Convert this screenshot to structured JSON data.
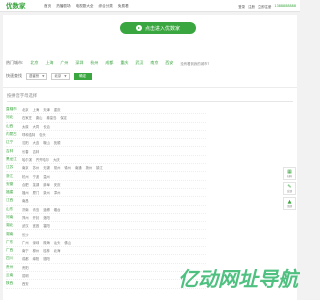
{
  "header": {
    "logo": "优数家",
    "nav": [
      "首页",
      "热播剧场",
      "电视剧大全",
      "综合分类",
      "免费看"
    ],
    "links": [
      "登录",
      "注册",
      "立即注册"
    ],
    "phone": "1388888888"
  },
  "main": {
    "enter_button": "点击进入优数家",
    "hot_cities": {
      "title": "热门城市:",
      "cities": [
        "北京",
        "上海",
        "广州",
        "深圳",
        "杭州",
        "成都",
        "重庆",
        "武汉",
        "南京",
        "西安"
      ],
      "more": "没有看到我的城市?"
    },
    "quick_select": {
      "title": "快速查找",
      "province": "选省份",
      "city": "北京",
      "go": "确定"
    },
    "az_title": "按拼音字母选择",
    "provinces": [
      {
        "name": "直辖市",
        "cities": [
          "北京",
          "上海",
          "天津",
          "重庆"
        ]
      },
      {
        "name": "河北",
        "cities": [
          "石家庄",
          "唐山",
          "秦皇岛",
          "保定"
        ]
      },
      {
        "name": "山西",
        "cities": [
          "太原",
          "大同",
          "长治"
        ]
      },
      {
        "name": "内蒙古",
        "cities": [
          "呼和浩特",
          "包头"
        ]
      },
      {
        "name": "辽宁",
        "cities": [
          "沈阳",
          "大连",
          "鞍山",
          "抚顺"
        ]
      },
      {
        "name": "吉林",
        "cities": [
          "长春",
          "吉林"
        ]
      },
      {
        "name": "黑龙江",
        "cities": [
          "哈尔滨",
          "齐齐哈尔",
          "大庆"
        ]
      },
      {
        "name": "江苏",
        "cities": [
          "南京",
          "苏州",
          "无锡",
          "常州",
          "徐州",
          "南通",
          "扬州",
          "镇江"
        ]
      },
      {
        "name": "浙江",
        "cities": [
          "杭州",
          "宁波",
          "温州"
        ]
      },
      {
        "name": "安徽",
        "cities": [
          "合肥",
          "芜湖",
          "蚌埠",
          "安庆"
        ]
      },
      {
        "name": "福建",
        "cities": [
          "福州",
          "厦门",
          "泉州",
          "漳州"
        ]
      },
      {
        "name": "江西",
        "cities": [
          "南昌"
        ]
      },
      {
        "name": "山东",
        "cities": [
          "济南",
          "青岛",
          "淄博",
          "烟台"
        ]
      },
      {
        "name": "河南",
        "cities": [
          "郑州",
          "开封",
          "洛阳"
        ]
      },
      {
        "name": "湖北",
        "cities": [
          "武汉",
          "宜昌",
          "襄阳"
        ]
      },
      {
        "name": "湖南",
        "cities": [
          "长沙"
        ]
      },
      {
        "name": "广东",
        "cities": [
          "广州",
          "深圳",
          "珠海",
          "汕头",
          "佛山"
        ]
      },
      {
        "name": "广西",
        "cities": [
          "南宁",
          "柳州",
          "桂林",
          "北海"
        ]
      },
      {
        "name": "四川",
        "cities": [
          "成都",
          "绵阳",
          "德阳"
        ]
      },
      {
        "name": "贵州",
        "cities": [
          "贵阳"
        ]
      },
      {
        "name": "云南",
        "cities": [
          "昆明"
        ]
      },
      {
        "name": "陕西",
        "cities": [
          "西安"
        ]
      }
    ]
  },
  "side_tools": [
    {
      "icon": "qr-code-icon",
      "label": "扫码"
    },
    {
      "icon": "feedback-icon",
      "label": "反馈"
    },
    {
      "icon": "top-arrow-icon",
      "label": "顶部"
    }
  ],
  "watermark": {
    "text": "亿动网址导航"
  },
  "colors": {
    "brand": "#3aa63f",
    "watermark": "#2fb56a"
  }
}
